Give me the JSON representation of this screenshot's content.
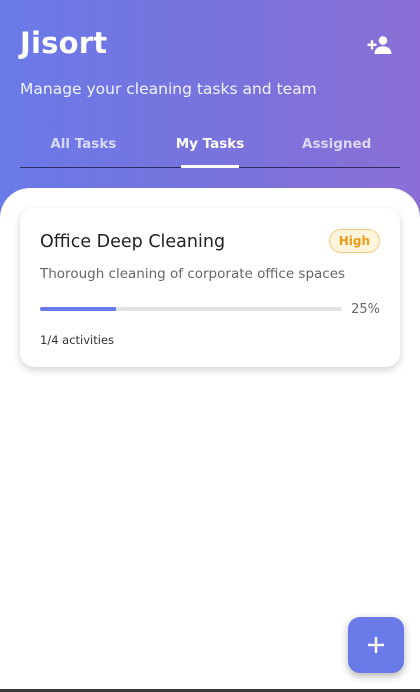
{
  "app": {
    "title": "Jisort",
    "subtitle": "Manage your cleaning tasks and team"
  },
  "header": {
    "add_member_icon": "person-add-icon",
    "gradient_start": "#6a7ae8",
    "gradient_end": "#8b6fd6"
  },
  "tabs": [
    {
      "label": "All Tasks",
      "active": false
    },
    {
      "label": "My Tasks",
      "active": true
    },
    {
      "label": "Assigned",
      "active": false
    }
  ],
  "task": {
    "title": "Office Deep Cleaning",
    "priority": "High",
    "priority_color": "#e99a18",
    "description": "Thorough cleaning of corporate office spaces",
    "progress_fraction": 0.25,
    "progress_label": "25%",
    "activities_label": "1/4 activities"
  },
  "fab": {
    "icon": "plus-icon",
    "color": "#6a7ae8"
  }
}
